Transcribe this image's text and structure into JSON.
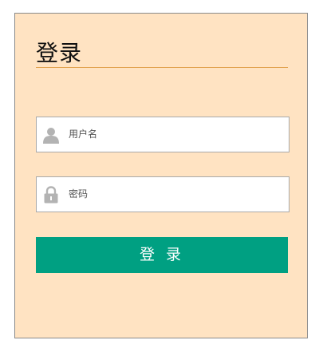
{
  "login": {
    "title": "登录",
    "username_placeholder": "用户名",
    "password_placeholder": "密码",
    "submit_label": "登 录"
  },
  "colors": {
    "panel_background": "#ffe3c2",
    "title_underline": "#e0a04a",
    "button_background": "#00a082",
    "icon": "#b3b3b3"
  },
  "icons": {
    "username": "user-icon",
    "password": "lock-icon"
  }
}
